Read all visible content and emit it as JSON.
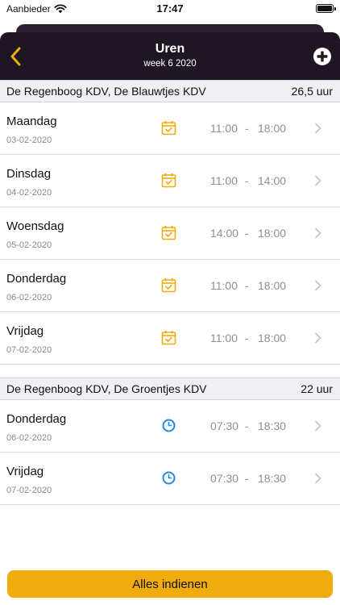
{
  "status_bar": {
    "carrier": "Aanbieder",
    "time": "17:47"
  },
  "header": {
    "title": "Uren",
    "subtitle": "week 6 2020"
  },
  "colors": {
    "accent": "#f0ab0e",
    "nav_background": "#1f1623",
    "clock_icon": "#1e88e5"
  },
  "sections": [
    {
      "title": "De Regenboog KDV, De Blauwtjes KDV",
      "total": "26,5 uur",
      "rows": [
        {
          "day": "Maandag",
          "date": "03-02-2020",
          "icon": "calendar-check-icon",
          "start": "11:00",
          "dash": "-",
          "end": "18:00"
        },
        {
          "day": "Dinsdag",
          "date": "04-02-2020",
          "icon": "calendar-check-icon",
          "start": "11:00",
          "dash": "-",
          "end": "14:00"
        },
        {
          "day": "Woensdag",
          "date": "05-02-2020",
          "icon": "calendar-check-icon",
          "start": "14:00",
          "dash": "-",
          "end": "18:00"
        },
        {
          "day": "Donderdag",
          "date": "06-02-2020",
          "icon": "calendar-check-icon",
          "start": "11:00",
          "dash": "-",
          "end": "18:00"
        },
        {
          "day": "Vrijdag",
          "date": "07-02-2020",
          "icon": "calendar-check-icon",
          "start": "11:00",
          "dash": "-",
          "end": "18:00"
        }
      ]
    },
    {
      "title": "De Regenboog KDV, De Groentjes KDV",
      "total": "22 uur",
      "rows": [
        {
          "day": "Donderdag",
          "date": "06-02-2020",
          "icon": "clock-icon",
          "start": "07:30",
          "dash": "-",
          "end": "18:30"
        },
        {
          "day": "Vrijdag",
          "date": "07-02-2020",
          "icon": "clock-icon",
          "start": "07:30",
          "dash": "-",
          "end": "18:30"
        }
      ]
    }
  ],
  "footer": {
    "submit_label": "Alles indienen"
  }
}
